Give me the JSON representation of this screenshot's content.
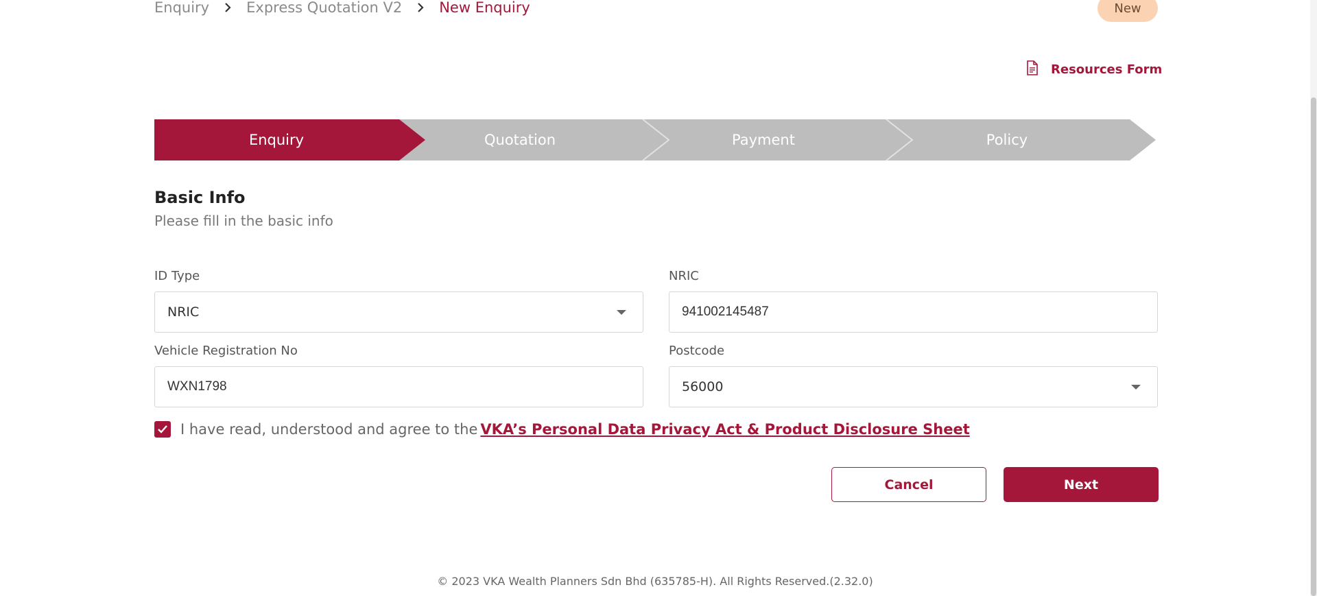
{
  "breadcrumb": {
    "items": [
      "Enquiry",
      "Express Quotation V2"
    ],
    "current": "New Enquiry"
  },
  "status_badge": "New",
  "resources_form": {
    "label": "Resources Form",
    "icon": "document-icon"
  },
  "stepper": {
    "steps": [
      "Enquiry",
      "Quotation",
      "Payment",
      "Policy"
    ],
    "active_index": 0,
    "active_color": "#a5173a",
    "inactive_color": "#bdbdbd"
  },
  "basic_info": {
    "title": "Basic Info",
    "subtitle": "Please fill in the basic info"
  },
  "form": {
    "id_type": {
      "label": "ID Type",
      "value": "NRIC"
    },
    "nric": {
      "label": "NRIC",
      "value": "941002145487"
    },
    "vehicle_reg": {
      "label": "Vehicle Registration No",
      "value": "WXN1798"
    },
    "postcode": {
      "label": "Postcode",
      "value": "56000"
    }
  },
  "consent": {
    "checked": true,
    "text": "I have read, understood and agree to the",
    "link": "VKA’s Personal Data Privacy Act & Product Disclosure Sheet"
  },
  "buttons": {
    "cancel": "Cancel",
    "next": "Next"
  },
  "footer": "© 2023 VKA Wealth Planners Sdn Bhd (635785-H). All Rights Reserved.(2.32.0)"
}
